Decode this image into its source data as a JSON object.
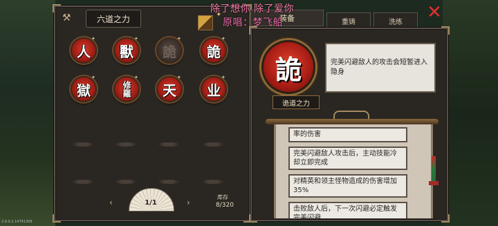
{
  "build_id": "2.9.0.2.14741309",
  "left_panel": {
    "title": "六道之力",
    "powers": [
      {
        "glyph": "人",
        "active": true
      },
      {
        "glyph": "獸",
        "active": true
      },
      {
        "glyph": "詭",
        "active": false
      },
      {
        "glyph": "詭",
        "active": true
      },
      {
        "glyph": "獄",
        "active": true
      },
      {
        "glyph": "修羅",
        "active": true
      },
      {
        "glyph": "天",
        "active": true
      },
      {
        "glyph": "业",
        "active": true
      }
    ],
    "page": "1/1",
    "stock_label": "库存",
    "stock_count": "8/320"
  },
  "tabs": {
    "equip": "装备",
    "forge": "重铸",
    "wash": "洗练"
  },
  "overlay": {
    "line1": "除了想你 除了爱你",
    "line2": "原唱：梦飞船"
  },
  "detail": {
    "glyph": "詭",
    "name": "诡道之力",
    "description": "完美闪避敌人的攻击会短暂进入隐身"
  },
  "perks": [
    "率的伤害",
    "完美闪避敌人攻击后，主动技能冷却立即完成",
    "对精英和领主怪物造成的伤害增加35%",
    "击败敌人后，下一次闪避必定触发完美闪避"
  ],
  "colors": {
    "orb_red": "#c2271d",
    "lyric_pink": "#f37aa9",
    "close_red": "#e23030"
  }
}
